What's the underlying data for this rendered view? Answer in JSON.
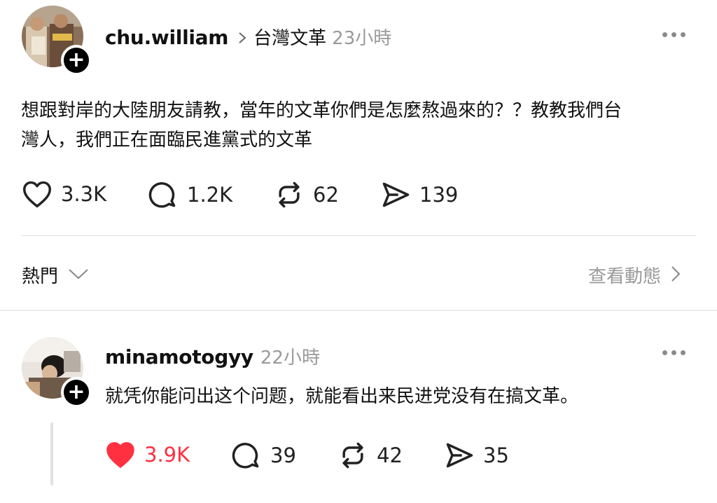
{
  "post": {
    "username": "chu.william",
    "community": "台灣文革",
    "time": "23小時",
    "text_line1": "想跟對岸的大陸朋友請教，當年的文革你們是怎麼熬過來的？？教教我們台",
    "text_line2": "灣人，我們正在面臨民進黨式的文革",
    "likes": "3.3K",
    "replies": "1.2K",
    "reposts": "62",
    "shares": "139"
  },
  "sort": {
    "label": "熱門",
    "view_activity": "查看動態"
  },
  "reply": {
    "username": "minamotogyy",
    "time": "22小時",
    "text": "就凭你能问出这个问题，就能看出来民进党没有在搞文革。",
    "likes": "3.9K",
    "replies": "39",
    "reposts": "42",
    "shares": "35",
    "liked": true
  },
  "colors": {
    "liked": "#ff3040",
    "muted": "#9a9a9a"
  }
}
